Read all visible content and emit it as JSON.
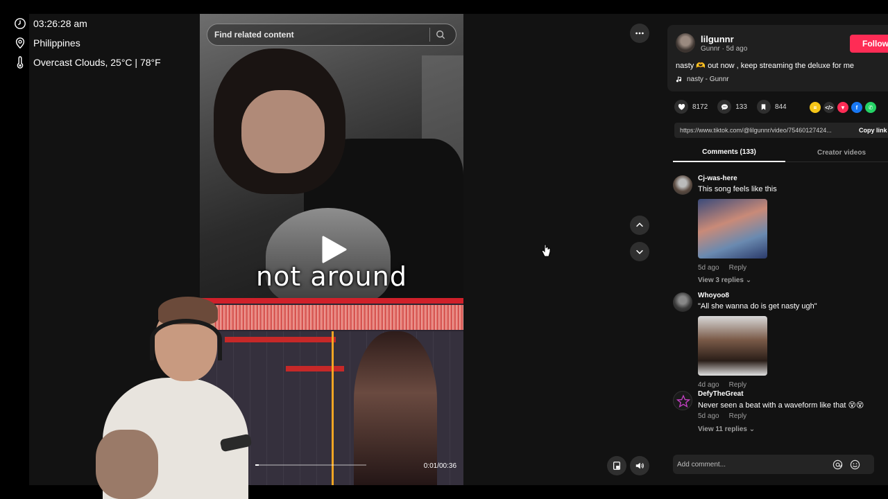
{
  "overlay": {
    "time": "03:26:28 am",
    "location": "Philippines",
    "weather": "Overcast Clouds, 25°C | 78°F"
  },
  "search": {
    "placeholder": "Find related content"
  },
  "video": {
    "caption": "not around",
    "time": "0:01/00:36",
    "progress": 0.03
  },
  "author": {
    "username": "lilgunnr",
    "subtitle": "Gunnr · 5d ago",
    "follow_label": "Follow",
    "description": "nasty 🫶 out now , keep streaming the deluxe for me",
    "music": "nasty - Gunnr"
  },
  "stats": {
    "likes": "8172",
    "comments": "133",
    "saves": "844"
  },
  "link": {
    "url": "https://www.tiktok.com/@lilgunnr/video/75460127424...",
    "copy_label": "Copy link"
  },
  "tabs": {
    "comments": "Comments (133)",
    "creator": "Creator videos"
  },
  "comments": [
    {
      "user": "Cj-was-here",
      "text": "This song feels like this",
      "meta": "5d ago",
      "reply": "Reply",
      "replies": "View 3 replies"
    },
    {
      "user": "Whoyoo8",
      "text": "\"All she wanna do is get nasty ugh\"",
      "meta": "4d ago",
      "reply": "Reply"
    },
    {
      "user": "DefyTheGreat",
      "text": "Never seen a beat with a waveform like that 😵😵",
      "meta": "5d ago",
      "reply": "Reply",
      "replies": "View 11 replies"
    }
  ],
  "add_comment": {
    "placeholder": "Add comment..."
  },
  "colors": {
    "accent": "#fe2c55",
    "panel": "#121212",
    "card": "#1f1f1f"
  }
}
